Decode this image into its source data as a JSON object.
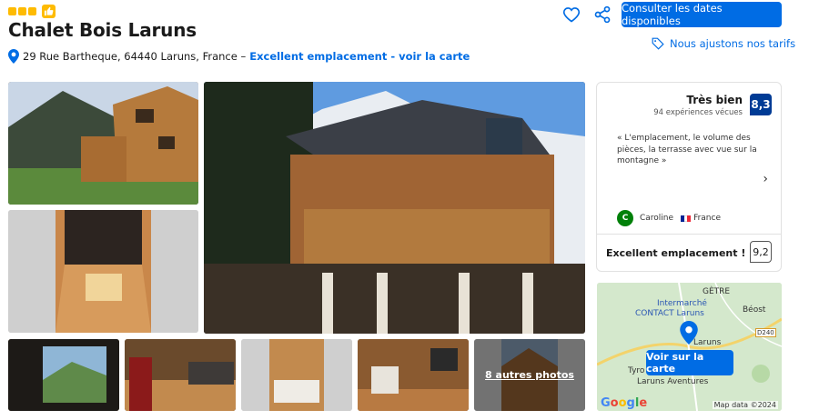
{
  "header": {
    "stars": 3,
    "title": "Chalet Bois Laruns",
    "address": "29 Rue Bartheque, 64440 Laruns, France –",
    "location_link": "Excellent emplacement - voir la carte",
    "cta_label": "Consulter les dates disponibles",
    "price_match": "Nous ajustons nos tarifs",
    "icons": [
      "heart-icon",
      "share-icon",
      "tag-icon",
      "map-pin-icon",
      "thumbs-up-icon"
    ],
    "accent": "#006ce4",
    "star_color": "#febb02"
  },
  "review": {
    "label": "Très bien",
    "count": "94 expériences vécues",
    "score": "8,3",
    "quote": "« L'emplacement, le volume des pièces, la terrasse avec vue sur la montagne »",
    "reviewer_initial": "C",
    "reviewer_name": "Caroline",
    "reviewer_country": "France",
    "location_label": "Excellent emplacement !",
    "location_score": "9,2",
    "score_color": "#003b95"
  },
  "map": {
    "labels": {
      "getre": "GÈTRE",
      "intermarche_1": "Intermarché",
      "intermarche_2": "CONTACT Laruns",
      "beost": "Béost",
      "road": "D240",
      "laruns": "Laruns",
      "tyro": "Tyro",
      "aventures": "Laruns Aventures"
    },
    "button": "Voir sur la carte",
    "google": "Google",
    "attribution": "Map data ©2024"
  },
  "gallery": {
    "more_photos": "8 autres photos"
  }
}
